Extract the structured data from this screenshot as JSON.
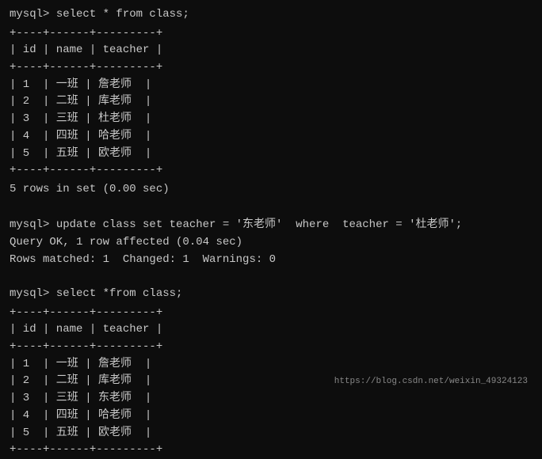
{
  "terminal": {
    "prompt": "mysql>",
    "query1": "select * from class;",
    "query2": "update class set teacher = '东老师'  where  teacher = '杜老师';",
    "query2_result1": "Query OK, 1 row affected (0.04 sec)",
    "query2_result2": "Rows matched: 1  Changed: 1  Warnings: 0",
    "query3": "select *from class;",
    "rows_result": "5 rows in set (0.00 sec)",
    "table1": {
      "border_top": "+----+------+---------+",
      "header": "| id | name | teacher |",
      "border_mid": "+----+------+---------+",
      "rows": [
        "| 1  | 一班 | 詹老师  |",
        "| 2  | 二班 | 库老师  |",
        "| 3  | 三班 | 杜老师  |",
        "| 4  | 四班 | 哈老师  |",
        "| 5  | 五班 | 欧老师  |"
      ],
      "border_bottom": "+----+------+---------+"
    },
    "table2": {
      "border_top": "+----+------+---------+",
      "header": "| id | name | teacher |",
      "border_mid": "+----+------+---------+",
      "rows": [
        "| 1  | 一班 | 詹老师  |",
        "| 2  | 二班 | 库老师  |",
        "| 3  | 三班 | 东老师  |",
        "| 4  | 四班 | 哈老师  |",
        "| 5  | 五班 | 欧老师  |"
      ],
      "border_bottom": "+----+------+---------+"
    },
    "watermark": "https://blog.csdn.net/weixin_49324123"
  }
}
